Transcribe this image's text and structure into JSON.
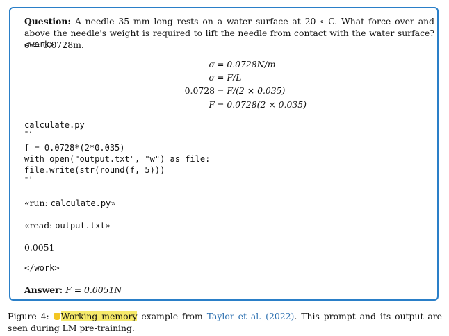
{
  "question": {
    "label": "Question:",
    "text": "A needle 35 mm long rests on a water surface at 20 ∘ C. What force over and above the needle's weight is required to lift the needle from contact with the water surface? σ = 0.0728m."
  },
  "work_open": "<work>",
  "equations": [
    {
      "lhs": "σ",
      "rhs": "= 0.0728N/m"
    },
    {
      "lhs": "σ",
      "rhs": "= F/L"
    },
    {
      "lhs": "0.0728",
      "rhs": "= F/(2 × 0.035)"
    },
    {
      "lhs": "F",
      "rhs": "= 0.0728(2 × 0.035)"
    }
  ],
  "code": {
    "filename": "calculate.py",
    "open_quote": "\"‘",
    "lines": [
      "f = 0.0728*(2*0.035)",
      "with open(\"output.txt\", \"w\") as file:",
      "file.write(str(round(f, 5)))"
    ],
    "close_quote": "\"’"
  },
  "run": {
    "pre": "«run: ",
    "cmd": "calculate.py",
    "post": "»"
  },
  "read": {
    "pre": "«read: ",
    "cmd": "output.txt",
    "post": "»"
  },
  "result": "0.0051",
  "work_close": "</work>",
  "answer": {
    "label": "Answer:",
    "value": "F = 0.0051N"
  },
  "caption": {
    "prefix": "Figure 4:",
    "highlight": "Working memory",
    "middle": " example from ",
    "citation": "Taylor et al. (2022)",
    "suffix": ". This prompt and its output are seen during LM pre-training."
  },
  "colors": {
    "frame": "#2a7fc8",
    "citation": "#2b6fb0",
    "highlight": "#f7ea6a"
  }
}
